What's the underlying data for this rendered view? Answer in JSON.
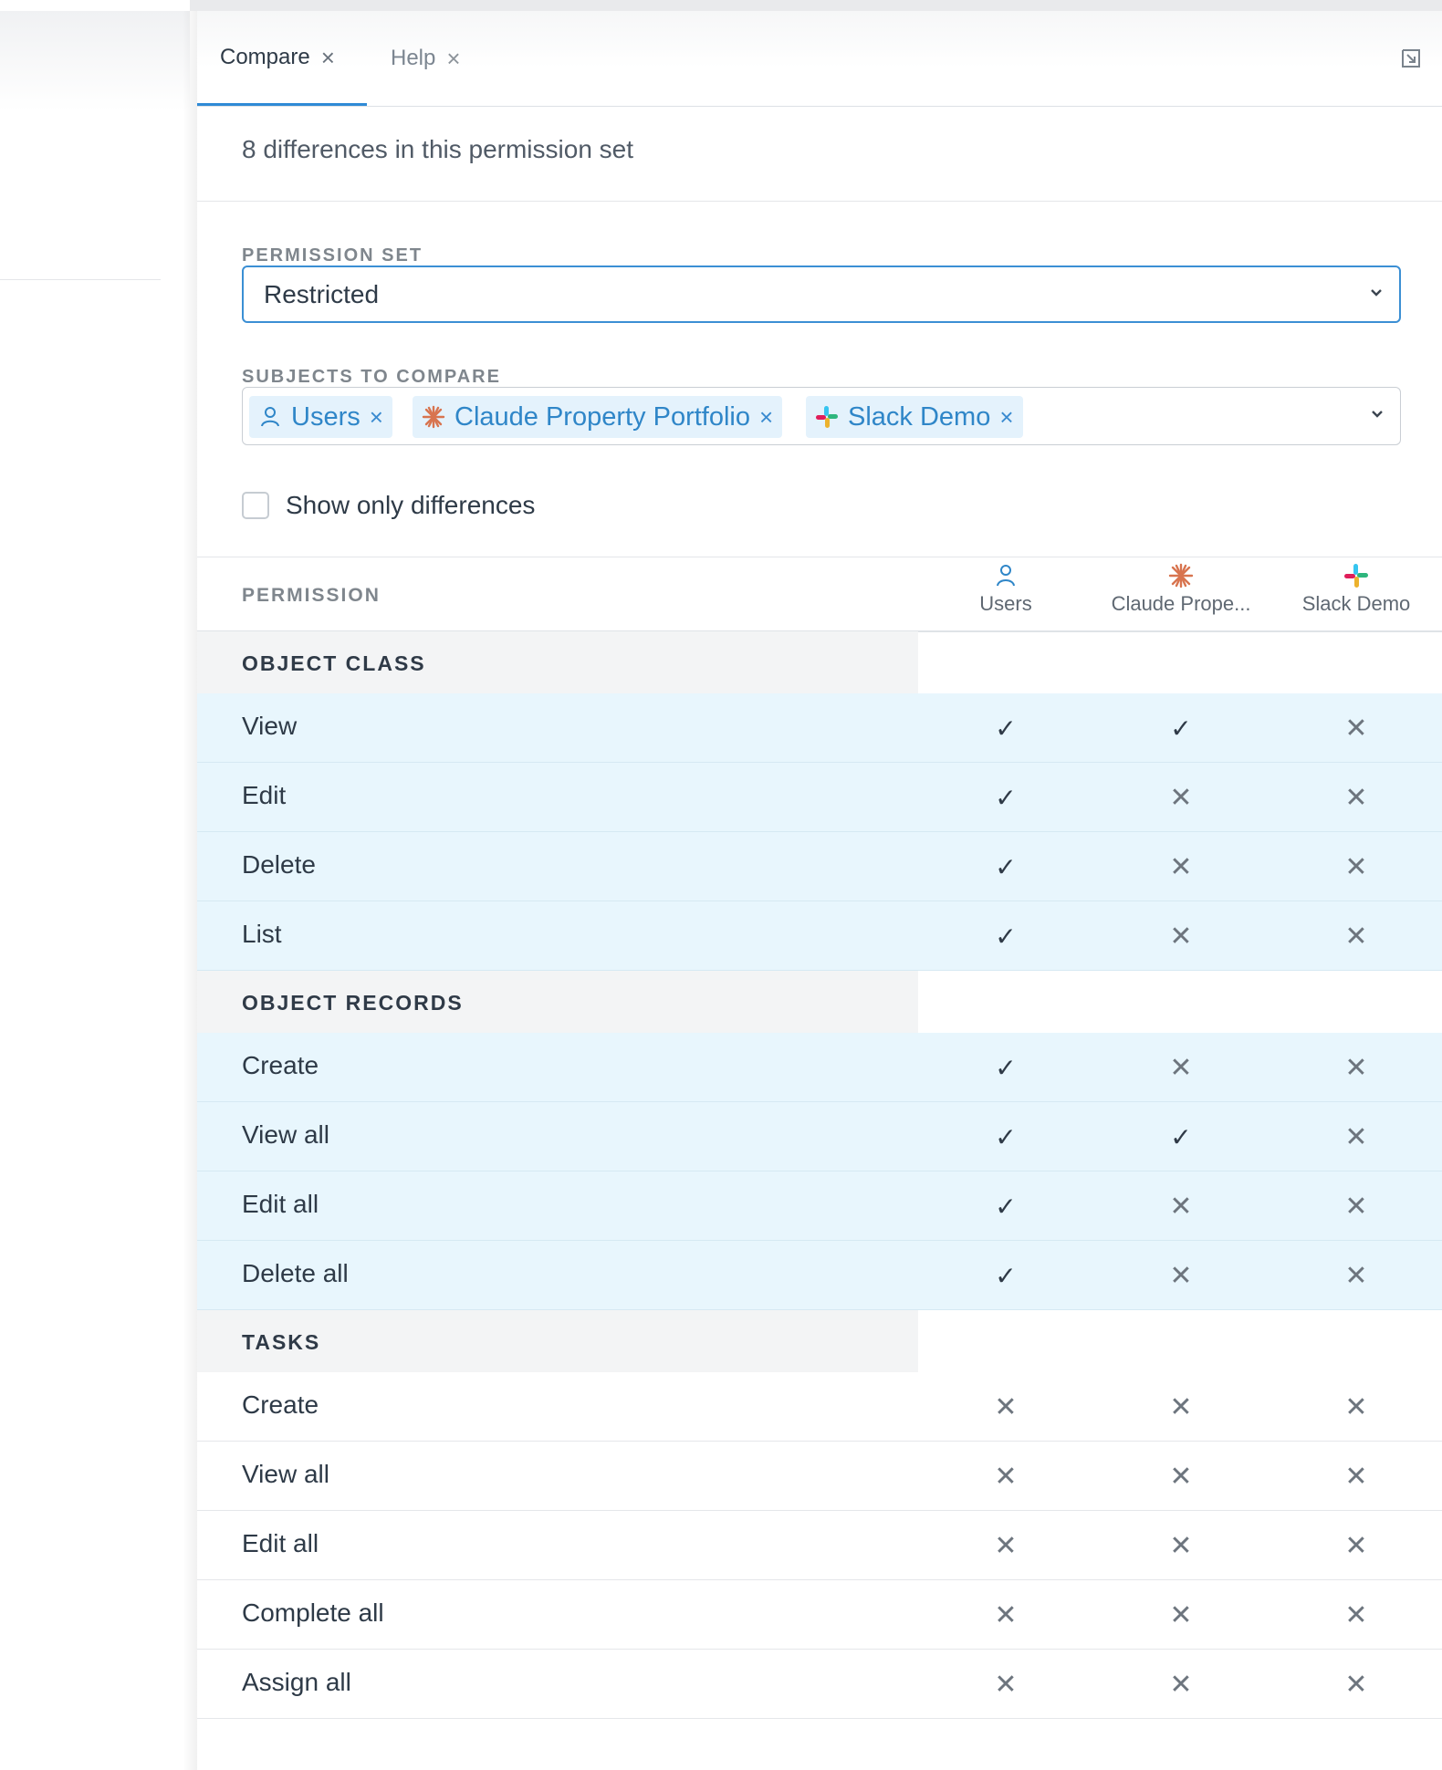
{
  "tabs": [
    {
      "label": "Compare",
      "active": true
    },
    {
      "label": "Help",
      "active": false
    }
  ],
  "icons": {
    "tab_close": "close-icon",
    "popout": "popout-icon",
    "chevron": "chevron-down-icon"
  },
  "summary": "8 differences in this permission set",
  "permission_set": {
    "label": "PERMISSION SET",
    "value": "Restricted"
  },
  "subjects": {
    "label": "SUBJECTS TO COMPARE",
    "chips": [
      {
        "label": "Users",
        "icon": "user-icon"
      },
      {
        "label": "Claude Property Portfolio",
        "icon": "claude-logo-icon"
      },
      {
        "label": "Slack Demo",
        "icon": "slack-logo-icon"
      }
    ]
  },
  "show_only_differences": {
    "label": "Show only differences",
    "checked": false
  },
  "table": {
    "permission_header": "PERMISSION",
    "columns": [
      "Users",
      "Claude Prope...",
      "Slack Demo"
    ],
    "sections": [
      {
        "title": "OBJECT CLASS",
        "rows": [
          {
            "name": "View",
            "values": [
              true,
              true,
              false
            ],
            "diff": true
          },
          {
            "name": "Edit",
            "values": [
              true,
              false,
              false
            ],
            "diff": true
          },
          {
            "name": "Delete",
            "values": [
              true,
              false,
              false
            ],
            "diff": true
          },
          {
            "name": "List",
            "values": [
              true,
              false,
              false
            ],
            "diff": true
          }
        ]
      },
      {
        "title": "OBJECT RECORDS",
        "rows": [
          {
            "name": "Create",
            "values": [
              true,
              false,
              false
            ],
            "diff": true
          },
          {
            "name": "View all",
            "values": [
              true,
              true,
              false
            ],
            "diff": true
          },
          {
            "name": "Edit all",
            "values": [
              true,
              false,
              false
            ],
            "diff": true
          },
          {
            "name": "Delete all",
            "values": [
              true,
              false,
              false
            ],
            "diff": true
          }
        ]
      },
      {
        "title": "TASKS",
        "rows": [
          {
            "name": "Create",
            "values": [
              false,
              false,
              false
            ],
            "diff": false
          },
          {
            "name": "View all",
            "values": [
              false,
              false,
              false
            ],
            "diff": false
          },
          {
            "name": "Edit all",
            "values": [
              false,
              false,
              false
            ],
            "diff": false
          },
          {
            "name": "Complete all",
            "values": [
              false,
              false,
              false
            ],
            "diff": false
          },
          {
            "name": "Assign all",
            "values": [
              false,
              false,
              false
            ],
            "diff": false
          }
        ]
      }
    ]
  },
  "colors": {
    "accent": "#2f8ad6",
    "diff_row": "#e8f6fd",
    "chip_bg": "#e4f2fc",
    "claude": "#d8744f"
  },
  "glyphs": {
    "check": "✓",
    "cross": "✕",
    "close": "×"
  }
}
